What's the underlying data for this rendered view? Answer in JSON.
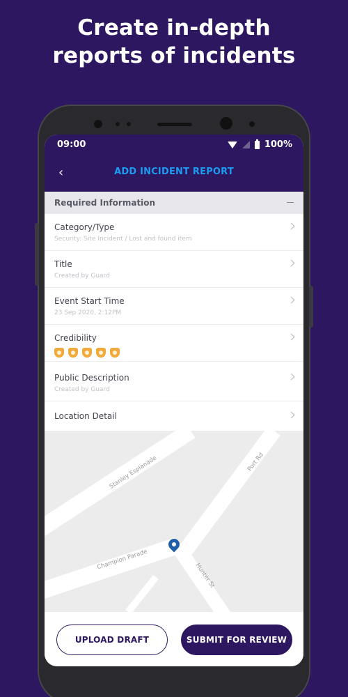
{
  "headline": {
    "line1": "Create in-depth",
    "line2": "reports of incidents"
  },
  "status_bar": {
    "time": "09:00",
    "battery": "100%"
  },
  "app_bar": {
    "back_icon": "chevron-left-icon",
    "title": "ADD INCIDENT REPORT"
  },
  "section": {
    "label": "Required Information"
  },
  "fields": [
    {
      "title": "Category/Type",
      "value": "Security: Site Incident / Lost and found item"
    },
    {
      "title": "Title",
      "value": "Created by Guard"
    },
    {
      "title": "Event Start Time",
      "value": "23 Sep 2020, 2:12PM"
    },
    {
      "title": "Credibility",
      "rating": 5,
      "rating_max": 5
    },
    {
      "title": "Public Description",
      "value": "Created by Guard"
    },
    {
      "title": "Location Detail"
    }
  ],
  "map": {
    "streets": [
      "Stanley Esplanade",
      "Port Rd",
      "Champion Parade",
      "Hunter St"
    ],
    "pin_color": "#1f5fa8"
  },
  "actions": {
    "upload_draft": "UPLOAD DRAFT",
    "submit": "SUBMIT FOR REVIEW"
  },
  "colors": {
    "primary": "#2c1760",
    "accent": "#1d9bf0",
    "badge": "#f2a93b"
  }
}
